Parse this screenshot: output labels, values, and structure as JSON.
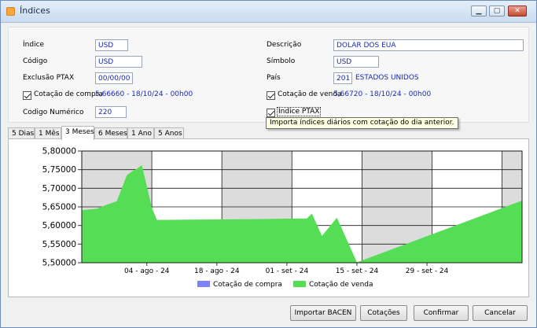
{
  "window": {
    "title": "Índices"
  },
  "form": {
    "indice_label": "Índice",
    "indice_value": "USD",
    "codigo_label": "Código",
    "codigo_value": "USD",
    "exclusao_label": "Exclusão PTAX",
    "exclusao_value": "00/00/00",
    "cot_compra_label": "Cotação de compra",
    "cot_compra_value": "5,66660 - 18/10/24 - 00h00",
    "codigo_numerico_label": "Codigo Numérico",
    "codigo_numerico_value": "220",
    "descricao_label": "Descrição",
    "descricao_value": "DOLAR DOS EUA",
    "simbolo_label": "Símbolo",
    "simbolo_value": "USD",
    "pais_label": "País",
    "pais_code": "201",
    "pais_name": "ESTADOS UNIDOS",
    "cot_venda_label": "Cotação de venda",
    "cot_venda_value": "5,66720 - 18/10/24 - 00h00",
    "indice_ptax_label": "Índice PTAX",
    "tooltip": "Importa índices diários com cotação do dia anterior."
  },
  "tabs": [
    {
      "label": "5 Dias"
    },
    {
      "label": "1 Mês"
    },
    {
      "label": "3 Meses",
      "active": true
    },
    {
      "label": "6 Meses"
    },
    {
      "label": "1 Ano"
    },
    {
      "label": "5 Anos"
    }
  ],
  "buttons": {
    "importar": "Importar BACEN",
    "cotacoes": "Cotações",
    "confirmar": "Confirmar",
    "cancelar": "Cancelar"
  },
  "colors": {
    "compra": "#8080ff",
    "venda": "#55dd55",
    "band": "#dcdcdc"
  },
  "chart_data": {
    "type": "area",
    "ylim": [
      5.5,
      5.8
    ],
    "yticks": [
      "5,80000",
      "5,75000",
      "5,70000",
      "5,65000",
      "5,60000",
      "5,55000",
      "5,50000"
    ],
    "xlim": [
      "2024-07-22",
      "2024-10-18"
    ],
    "xticks": [
      {
        "date": "2024-08-04",
        "label": "04 - ago - 24"
      },
      {
        "date": "2024-08-18",
        "label": "18 - ago - 24"
      },
      {
        "date": "2024-09-01",
        "label": "01 - set - 24"
      },
      {
        "date": "2024-09-15",
        "label": "15 - set - 24"
      },
      {
        "date": "2024-09-29",
        "label": "29 - set - 24"
      }
    ],
    "legend_position": "bottom",
    "series": [
      {
        "name": "Cotação de compra",
        "x": [],
        "y": []
      },
      {
        "name": "Cotação de venda",
        "x": [
          "2024-07-22",
          "2024-07-25",
          "2024-07-27",
          "2024-07-29",
          "2024-07-31",
          "2024-08-01",
          "2024-08-02",
          "2024-08-03",
          "2024-08-05",
          "2024-08-06",
          "2024-08-25",
          "2024-09-05",
          "2024-09-06",
          "2024-09-08",
          "2024-09-11",
          "2024-09-15",
          "2024-10-18"
        ],
        "y": [
          5.641,
          5.645,
          5.656,
          5.665,
          5.735,
          5.745,
          5.752,
          5.762,
          5.648,
          5.615,
          5.617,
          5.619,
          5.632,
          5.572,
          5.621,
          5.501,
          5.667
        ]
      }
    ]
  }
}
